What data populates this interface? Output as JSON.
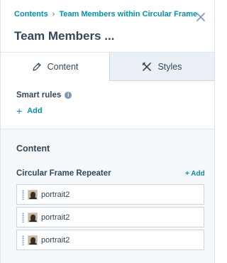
{
  "header": {
    "breadcrumb": [
      "Contents",
      "Team Members within Circular Frame"
    ],
    "title": "Team Members ...",
    "close_icon": "close-icon"
  },
  "tabs": [
    {
      "label": "Content",
      "icon": "pencil-icon",
      "active": true
    },
    {
      "label": "Styles",
      "icon": "styles-icon",
      "active": false
    }
  ],
  "smart_rules": {
    "label": "Smart rules",
    "add_label": "Add"
  },
  "content": {
    "heading": "Content",
    "repeater_label": "Circular Frame Repeater",
    "repeater_add": "+ Add",
    "items": [
      {
        "label": "portrait2"
      },
      {
        "label": "portrait2"
      },
      {
        "label": "portrait2"
      }
    ]
  },
  "colors": {
    "accent": "#0091ae",
    "text": "#33475b",
    "section_bg": "#f5f8fa",
    "inactive_tab_bg": "#eaf0f6"
  }
}
